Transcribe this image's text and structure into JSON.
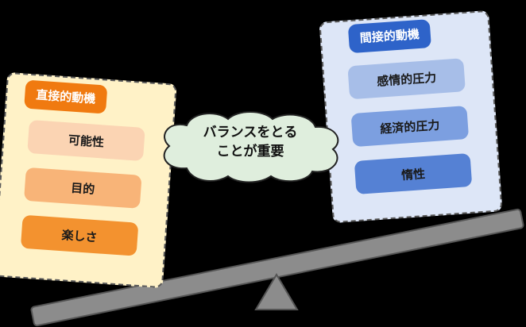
{
  "left_group": {
    "title": "直接的動機",
    "items": [
      "可能性",
      "目的",
      "楽しさ"
    ],
    "accent_color": "#f07a10",
    "background_color": "#fff2c7"
  },
  "right_group": {
    "title": "間接的動機",
    "items": [
      "感情的圧力",
      "経済的圧力",
      "惰性"
    ],
    "accent_color": "#2e63c9",
    "background_color": "#dde6f7"
  },
  "center_message": {
    "line1": "バランスをとる",
    "line2": "ことが重要"
  },
  "seesaw": {
    "tilt": "right side lower",
    "beam_color": "#8c8c8c",
    "fulcrum_shape": "triangle"
  }
}
